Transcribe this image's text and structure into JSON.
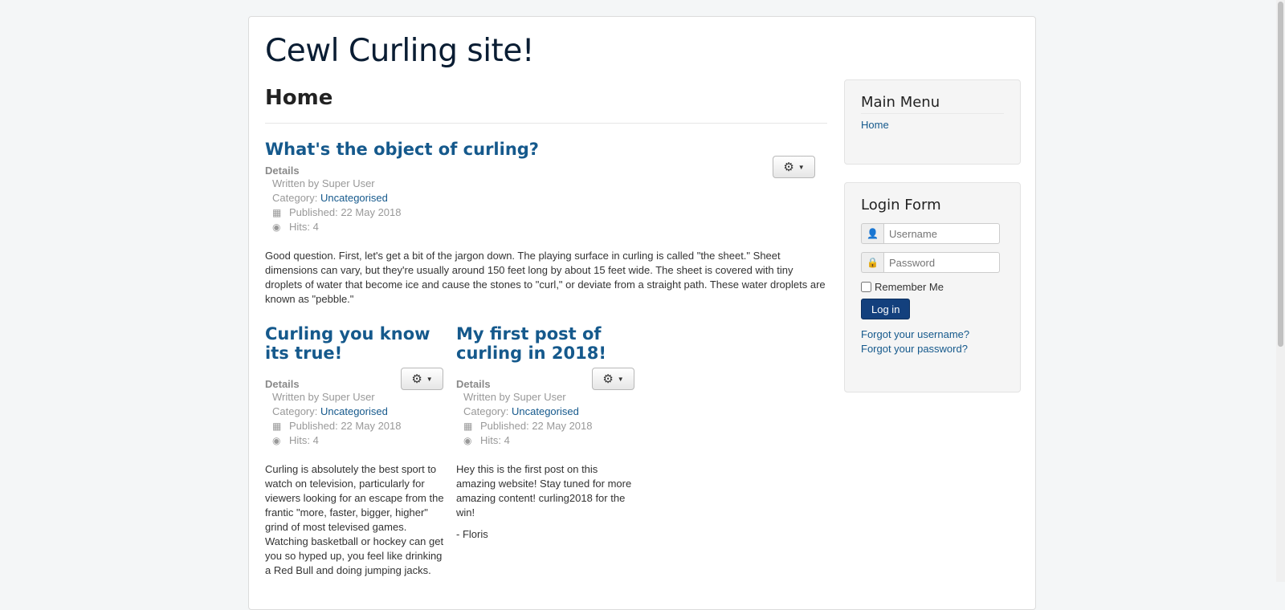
{
  "site_title": "Cewl Curling site!",
  "page_heading": "Home",
  "lead_article": {
    "title": "What's the object of curling?",
    "details_label": "Details",
    "written_by": "Written by Super User",
    "category_label": "Category:",
    "category": "Uncategorised",
    "published": "Published: 22 May 2018",
    "hits": "Hits: 4",
    "body": "Good question. First, let's get a bit of the jargon down. The playing surface in curling is called \"the sheet.\" Sheet dimensions can vary, but they're usually around 150 feet long by about 15 feet wide. The sheet is covered with tiny droplets of water that become ice and cause the stones to \"curl,\" or deviate from a straight path. These water droplets are known as \"pebble.\""
  },
  "articles": [
    {
      "title": "Curling you know its true!",
      "details_label": "Details",
      "written_by": "Written by Super User",
      "category_label": "Category:",
      "category": "Uncategorised",
      "published": "Published: 22 May 2018",
      "hits": "Hits: 4",
      "body": "Curling is absolutely the best sport to watch on television, particularly for viewers looking for an escape from the frantic \"more, faster, bigger, higher\" grind of most televised games. Watching basketball or hockey can get you so hyped up, you feel like drinking a Red Bull and doing jumping jacks."
    },
    {
      "title": "My first post of curling in 2018!",
      "details_label": "Details",
      "written_by": "Written by Super User",
      "category_label": "Category:",
      "category": "Uncategorised",
      "published": "Published: 22 May 2018",
      "hits": "Hits: 4",
      "body": "Hey this is the first post on this amazing website! Stay tuned for more amazing content! curling2018 for the win!",
      "signature": "- Floris"
    }
  ],
  "main_menu": {
    "title": "Main Menu",
    "items": [
      "Home"
    ]
  },
  "login_form": {
    "title": "Login Form",
    "username_placeholder": "Username",
    "password_placeholder": "Password",
    "remember_label": "Remember Me",
    "login_button": "Log in",
    "forgot_username": "Forgot your username?",
    "forgot_password": "Forgot your password?"
  },
  "icons": {
    "gear": "gear-icon",
    "calendar": "calendar-icon",
    "eye": "eye-icon",
    "user": "user-icon",
    "lock": "lock-icon",
    "caret": "caret-down-icon"
  },
  "colors": {
    "link": "#15598c",
    "login_button": "#13407d",
    "title": "#0a1d33"
  }
}
